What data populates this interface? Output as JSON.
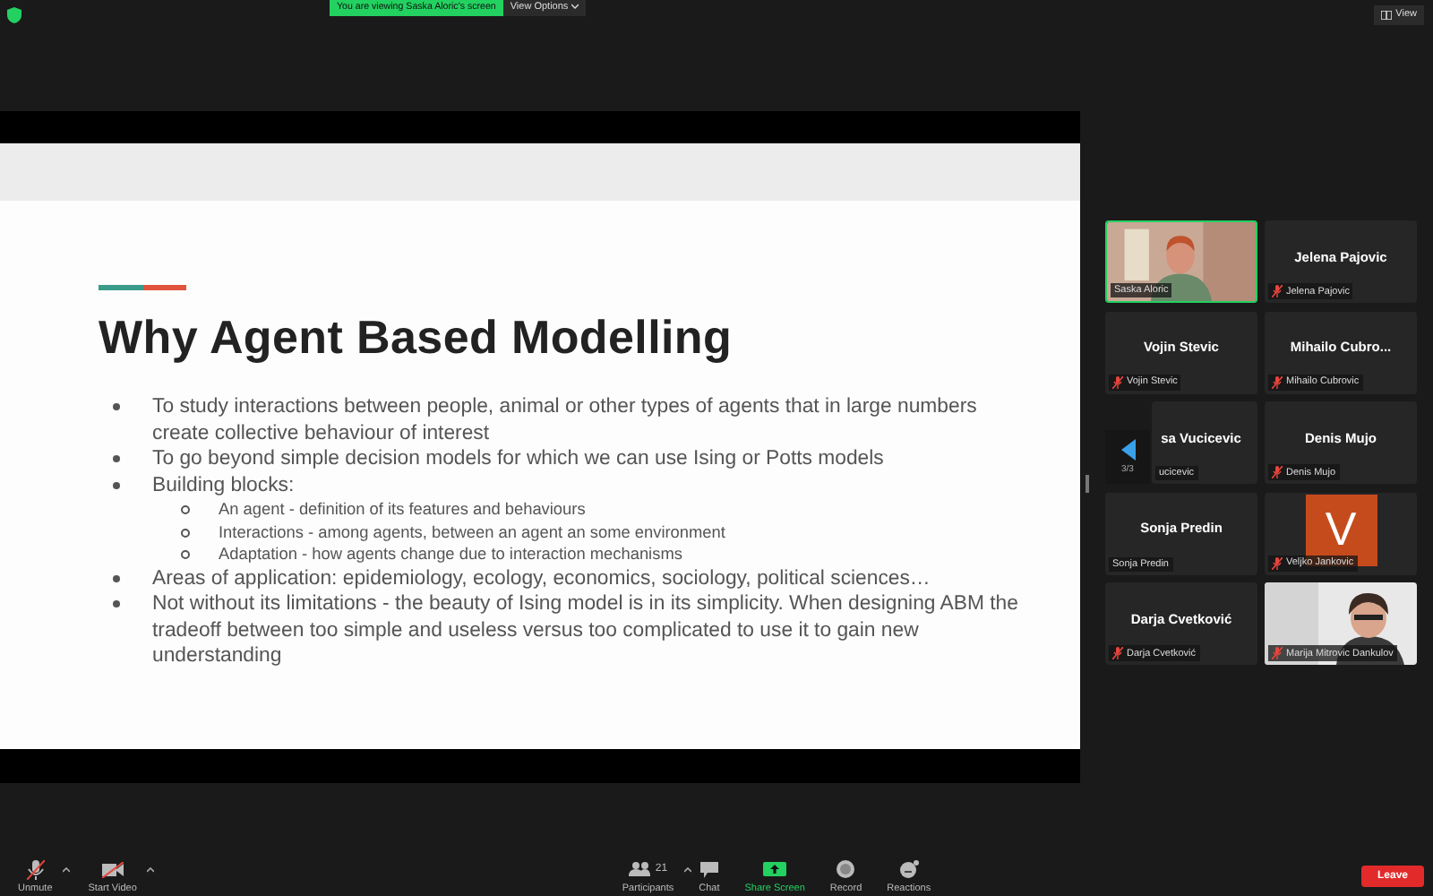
{
  "top_bar": {
    "banner": "You are viewing Saska Aloric's screen",
    "view_options": "View Options",
    "view_button": "View"
  },
  "slide": {
    "title": "Why Agent Based Modelling",
    "bullets": [
      {
        "text": "To study interactions between people, animal or other types of agents that in large numbers create collective behaviour of interest"
      },
      {
        "text": "To go beyond simple decision models for which we can use Ising or Potts models"
      },
      {
        "text": "Building blocks:",
        "children": [
          {
            "text": "An agent - definition of its features and behaviours"
          },
          {
            "text": "Interactions - among agents, between an agent an some environment"
          },
          {
            "text": "Adaptation - how agents change due to interaction mechanisms"
          }
        ]
      },
      {
        "text": "Areas of application: epidemiology, ecology, economics, sociology, political sciences…"
      },
      {
        "text": "Not without its limitations - the beauty of Ising model is in its simplicity. When designing ABM  the tradeoff between too simple and useless versus too complicated to use it to gain new understanding"
      }
    ]
  },
  "gallery": {
    "tiles": [
      {
        "kind": "video",
        "label": "Saska Aloric",
        "muted": false,
        "active": true
      },
      {
        "kind": "name",
        "name": "Jelena Pajovic",
        "label": "Jelena Pajovic",
        "muted": true,
        "active": false
      },
      {
        "kind": "name",
        "name": "Vojin Stevic",
        "label": "Vojin Stevic",
        "muted": true,
        "active": false
      },
      {
        "kind": "name",
        "name": "Mihailo Cubro...",
        "label": "Mihailo Cubrovic",
        "muted": true,
        "active": false
      },
      {
        "kind": "name",
        "name": "sa Vucicevic",
        "label": "ucicevic",
        "muted": false,
        "active": false
      },
      {
        "kind": "name",
        "name": "Denis Mujo",
        "label": "Denis Mujo",
        "muted": true,
        "active": false
      },
      {
        "kind": "name",
        "name": "Sonja Predin",
        "label": "Sonja Predin",
        "muted": false,
        "active": false
      },
      {
        "kind": "avatar",
        "letter": "V",
        "label": "Veljko Jankovic",
        "muted": true,
        "active": false
      },
      {
        "kind": "name",
        "name": "Darja Cvetković",
        "label": "Darja Cvetković",
        "muted": true,
        "active": false
      },
      {
        "kind": "video",
        "label": "Marija Mitrovic Dankulov",
        "muted": true,
        "active": false
      }
    ],
    "pager": "3/3"
  },
  "toolbar": {
    "left": [
      {
        "kind": "mic",
        "label": "Unmute"
      },
      {
        "kind": "camera",
        "label": "Start Video"
      }
    ],
    "center": [
      {
        "kind": "participants",
        "label": "Participants",
        "count": "21"
      },
      {
        "kind": "chat",
        "label": "Chat"
      },
      {
        "kind": "share",
        "label": "Share Screen"
      },
      {
        "kind": "record",
        "label": "Record"
      },
      {
        "kind": "reactions",
        "label": "Reactions"
      }
    ],
    "leave": "Leave"
  }
}
